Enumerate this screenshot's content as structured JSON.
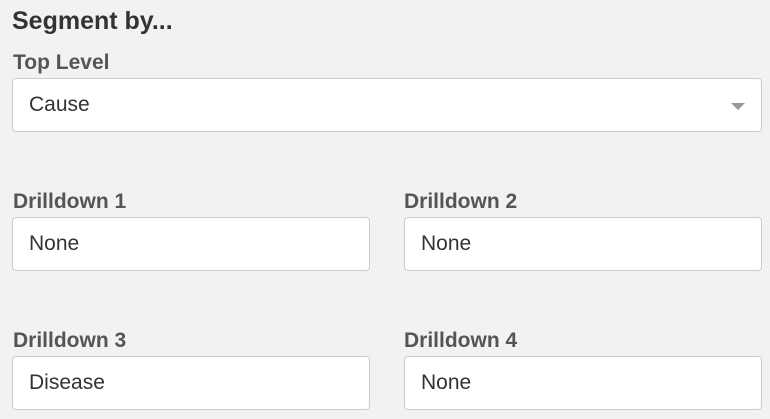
{
  "header": {
    "title": "Segment by..."
  },
  "top_level": {
    "label": "Top Level",
    "value": "Cause"
  },
  "drilldowns": [
    {
      "label": "Drilldown 1",
      "value": "None"
    },
    {
      "label": "Drilldown 2",
      "value": "None"
    },
    {
      "label": "Drilldown 3",
      "value": "Disease"
    },
    {
      "label": "Drilldown 4",
      "value": "None"
    }
  ],
  "colors": {
    "background": "#f2f2f2",
    "input_background": "#ffffff",
    "input_border": "#cccccc",
    "label_text": "#555555",
    "title_text": "#333333",
    "caret": "#999999"
  },
  "icons": {
    "dropdown": "chevron-down-icon"
  }
}
